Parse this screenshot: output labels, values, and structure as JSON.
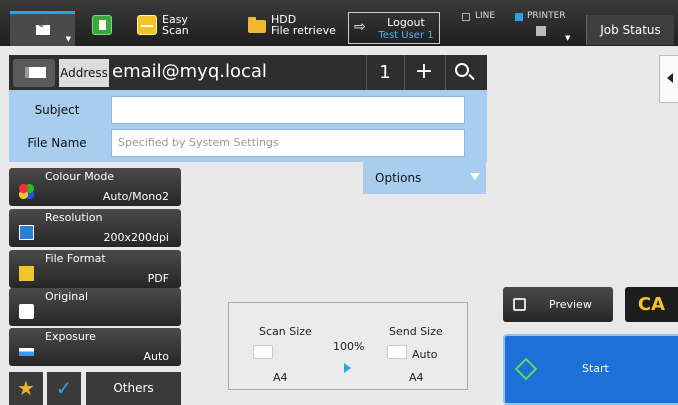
{
  "topbar": {
    "easy_scan_line1": "Easy",
    "easy_scan_line2": "Scan",
    "hdd_line1": "HDD",
    "hdd_line2": "File retrieve",
    "logout_label": "Logout",
    "logout_user": "Test User 1",
    "line_label": "LINE",
    "printer_label": "PRINTER",
    "job_status": "Job Status"
  },
  "address": {
    "label": "Address",
    "value": "email@myq.local",
    "count": "1",
    "plus": "+"
  },
  "form": {
    "subject_label": "Subject",
    "subject_value": "",
    "filename_label": "File Name",
    "filename_placeholder": "Specified by System Settings"
  },
  "settings": {
    "colour_mode": {
      "label": "Colour Mode",
      "value": "Auto/Mono2"
    },
    "resolution": {
      "label": "Resolution",
      "value": "200x200dpi"
    },
    "file_format": {
      "label": "File Format",
      "value": "PDF"
    },
    "original": {
      "label": "Original",
      "value": ""
    },
    "exposure": {
      "label": "Exposure",
      "value": "Auto"
    }
  },
  "options_label": "Options",
  "bottom": {
    "others_label": "Others",
    "star": "★",
    "check": "✓"
  },
  "scan": {
    "scan_size_label": "Scan Size",
    "send_size_label": "Send Size",
    "ratio": "100%",
    "send_auto": "Auto",
    "scan_size": "A4",
    "send_size": "A4"
  },
  "actions": {
    "preview": "Preview",
    "ca": "CA",
    "start": "Start"
  },
  "colors": {
    "accent": "#2aa3e8",
    "form_bg": "#a9cdef",
    "start_bg": "#1e6fd6",
    "ca_text": "#f2c42b"
  }
}
